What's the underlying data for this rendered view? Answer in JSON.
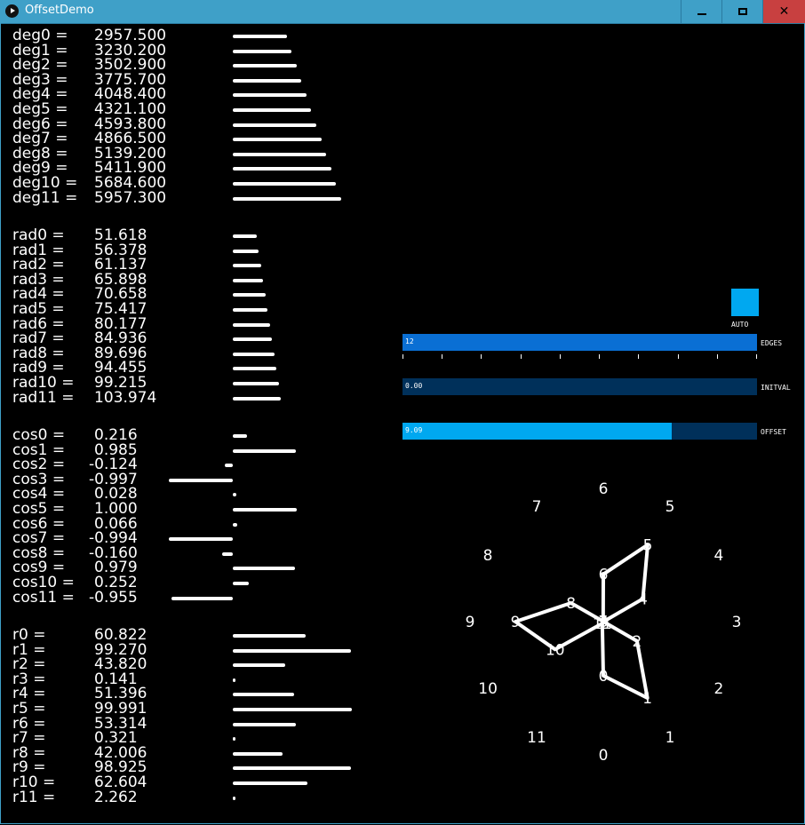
{
  "window": {
    "title": "OffsetDemo",
    "min_label": "minimize",
    "max_label": "maximize",
    "close_label": "✕"
  },
  "deg": [
    {
      "label": "deg0 =",
      "value": "2957.500",
      "bar": 0.496
    },
    {
      "label": "deg1 =",
      "value": "3230.200",
      "bar": 0.542
    },
    {
      "label": "deg2 =",
      "value": "3502.900",
      "bar": 0.588
    },
    {
      "label": "deg3 =",
      "value": "3775.700",
      "bar": 0.634
    },
    {
      "label": "deg4 =",
      "value": "4048.400",
      "bar": 0.68
    },
    {
      "label": "deg5 =",
      "value": "4321.100",
      "bar": 0.725
    },
    {
      "label": "deg6 =",
      "value": "4593.800",
      "bar": 0.771
    },
    {
      "label": "deg7 =",
      "value": "4866.500",
      "bar": 0.817
    },
    {
      "label": "deg8 =",
      "value": "5139.200",
      "bar": 0.863
    },
    {
      "label": "deg9 =",
      "value": "5411.900",
      "bar": 0.908
    },
    {
      "label": "deg10 =",
      "value": "5684.600",
      "bar": 0.954
    },
    {
      "label": "deg11 =",
      "value": "5957.300",
      "bar": 1.0
    }
  ],
  "rad": [
    {
      "label": "rad0 =",
      "value": "51.618",
      "bar": 0.496
    },
    {
      "label": "rad1 =",
      "value": "56.378",
      "bar": 0.542
    },
    {
      "label": "rad2 =",
      "value": "61.137",
      "bar": 0.588
    },
    {
      "label": "rad3 =",
      "value": "65.898",
      "bar": 0.634
    },
    {
      "label": "rad4 =",
      "value": "70.658",
      "bar": 0.68
    },
    {
      "label": "rad5 =",
      "value": "75.417",
      "bar": 0.725
    },
    {
      "label": "rad6 =",
      "value": "80.177",
      "bar": 0.771
    },
    {
      "label": "rad7 =",
      "value": "84.936",
      "bar": 0.817
    },
    {
      "label": "rad8 =",
      "value": "89.696",
      "bar": 0.863
    },
    {
      "label": "rad9 =",
      "value": "94.455",
      "bar": 0.908
    },
    {
      "label": "rad10 =",
      "value": "99.215",
      "bar": 0.954
    },
    {
      "label": "rad11 =",
      "value": "103.974",
      "bar": 1.0
    }
  ],
  "cos": [
    {
      "label": "cos0 =",
      "value": "0.216",
      "num": 0.216
    },
    {
      "label": "cos1 =",
      "value": "0.985",
      "num": 0.985
    },
    {
      "label": "cos2 =",
      "value": "-0.124",
      "num": -0.124
    },
    {
      "label": "cos3 =",
      "value": "-0.997",
      "num": -0.997
    },
    {
      "label": "cos4 =",
      "value": "0.028",
      "num": 0.028
    },
    {
      "label": "cos5 =",
      "value": "1.000",
      "num": 1.0
    },
    {
      "label": "cos6 =",
      "value": "0.066",
      "num": 0.066
    },
    {
      "label": "cos7 =",
      "value": "-0.994",
      "num": -0.994
    },
    {
      "label": "cos8 =",
      "value": "-0.160",
      "num": -0.16
    },
    {
      "label": "cos9 =",
      "value": "0.979",
      "num": 0.979
    },
    {
      "label": "cos10 =",
      "value": "0.252",
      "num": 0.252
    },
    {
      "label": "cos11 =",
      "value": "-0.955",
      "num": -0.955
    }
  ],
  "r": [
    {
      "label": "r0 =",
      "value": "60.822",
      "num": 60.822
    },
    {
      "label": "r1 =",
      "value": "99.270",
      "num": 99.27
    },
    {
      "label": "r2 =",
      "value": "43.820",
      "num": 43.82
    },
    {
      "label": "r3 =",
      "value": "0.141",
      "num": 0.141
    },
    {
      "label": "r4 =",
      "value": "51.396",
      "num": 51.396
    },
    {
      "label": "r5 =",
      "value": "99.991",
      "num": 99.991
    },
    {
      "label": "r6 =",
      "value": "53.314",
      "num": 53.314
    },
    {
      "label": "r7 =",
      "value": "0.321",
      "num": 0.321
    },
    {
      "label": "r8 =",
      "value": "42.006",
      "num": 42.006
    },
    {
      "label": "r9 =",
      "value": "98.925",
      "num": 98.925
    },
    {
      "label": "r10 =",
      "value": "62.604",
      "num": 62.604
    },
    {
      "label": "r11 =",
      "value": "2.262",
      "num": 2.262
    }
  ],
  "controls": {
    "auto": {
      "label": "AUTO",
      "color": "#00a8f0"
    },
    "edges": {
      "label": "EDGES",
      "value_text": "12",
      "fill": 1.0,
      "color": "#0a6fd4"
    },
    "initval": {
      "label": "INITVAL",
      "value_text": "0.00",
      "fill": 0.0,
      "color": "#00305a"
    },
    "offset": {
      "label": "OFFSET",
      "value_text": "9.09",
      "fill": 0.76,
      "color": "#00a8f0"
    }
  },
  "polygon": {
    "outer_labels": [
      "0",
      "1",
      "2",
      "3",
      "4",
      "5",
      "6",
      "7",
      "8",
      "9",
      "10",
      "11"
    ],
    "vertex_labels": [
      "0",
      "1",
      "2",
      "3",
      "4",
      "5",
      "6",
      "7",
      "8",
      "9",
      "10",
      "11"
    ],
    "stroke": "#ffffff"
  }
}
